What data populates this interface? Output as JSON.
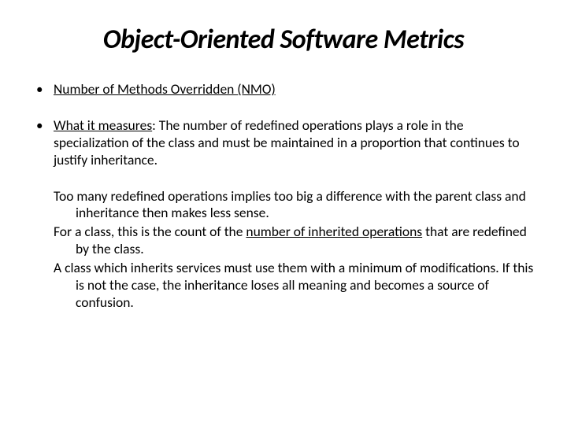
{
  "title": "Object-Oriented Software Metrics",
  "bullets": {
    "b1": "Number of Methods Overridden (NMO)",
    "b2_lead": "What it measures",
    "b2_rest": ": The number of redefined operations plays a role in the specialization of the class and must be maintained in a proportion that continues to justify inheritance."
  },
  "paras": {
    "p1": "Too many redefined operations implies too big a difference with the parent class and inheritance then makes less sense.",
    "p2_a": "For a class, this is the count of the ",
    "p2_u": "number of inherited operations",
    "p2_b": " that are redefined by the class.",
    "p3": "A class which inherits services must use them with a minimum of modifications.  If this is not the case, the inheritance loses all meaning and becomes a source of confusion."
  }
}
